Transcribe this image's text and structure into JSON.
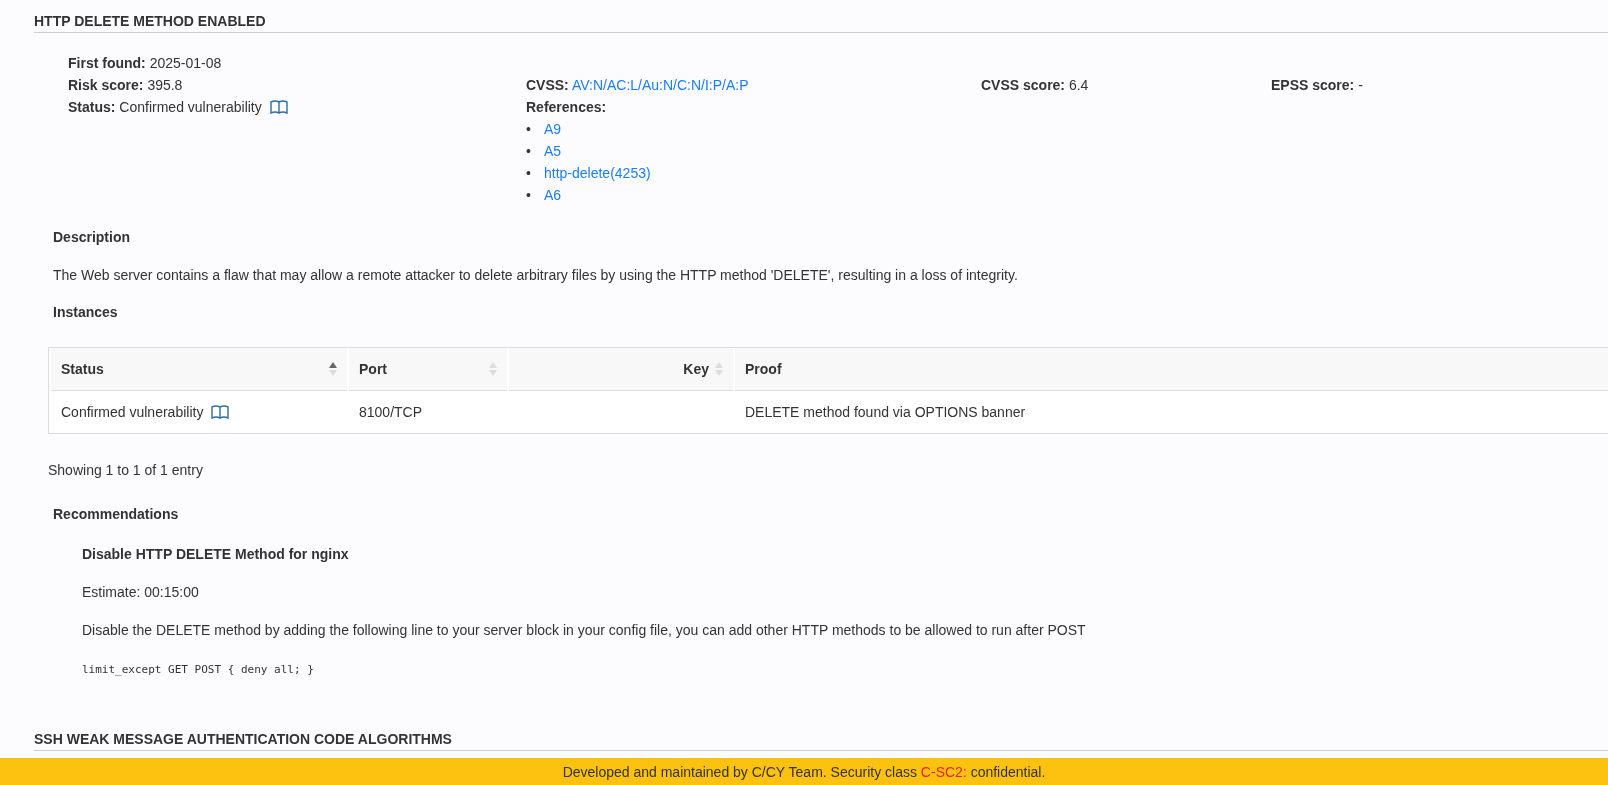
{
  "section_title": "HTTP DELETE METHOD ENABLED",
  "details": {
    "first_found": {
      "label": "First found:",
      "value": "2025-01-08"
    },
    "risk_score": {
      "label": "Risk score:",
      "value": "395.8"
    },
    "status": {
      "label": "Status:",
      "value": "Confirmed vulnerability"
    },
    "cvss": {
      "label": "CVSS:",
      "value": "AV:N/AC:L/Au:N/C:N/I:P/A:P"
    },
    "cvss_score": {
      "label": "CVSS score:",
      "value": "6.4"
    },
    "epss_score": {
      "label": "EPSS score:",
      "value": "-"
    },
    "references": {
      "label": "References:",
      "items": [
        {
          "bullet": "•",
          "text": "A9"
        },
        {
          "bullet": "•",
          "text": "A5"
        },
        {
          "bullet": "•",
          "text": "http-delete(4253)"
        },
        {
          "bullet": "•",
          "text": "A6"
        }
      ]
    }
  },
  "description": {
    "heading": "Description",
    "text": "The Web server contains a flaw that may allow a remote attacker to delete arbitrary files by using the HTTP method 'DELETE', resulting in a loss of integrity."
  },
  "instances": {
    "heading": "Instances",
    "columns": [
      {
        "kind": "sortable",
        "label": "Status",
        "sorted": true
      },
      {
        "kind": "sortable",
        "label": "Port",
        "sorted": false
      },
      {
        "kind": "sortable",
        "label": "Key",
        "sorted": false
      },
      {
        "kind": "plain",
        "label": "Proof"
      }
    ],
    "rows": [
      [
        "Confirmed vulnerability",
        "8100/TCP",
        "",
        "DELETE method found via OPTIONS banner"
      ]
    ],
    "info": "Showing 1 to 1 of 1 entry"
  },
  "recommendations": {
    "heading": "Recommendations",
    "items": [
      {
        "title": "Disable HTTP DELETE Method for nginx",
        "estimate": "Estimate: 00:15:00",
        "text": "Disable the DELETE method by adding the following line to your server block in your config file, you can add other HTTP methods to be allowed to run after POST",
        "code": "limit_except GET POST { deny all; }"
      }
    ]
  },
  "next_section_title": "SSH WEAK MESSAGE AUTHENTICATION CODE ALGORITHMS",
  "footer": {
    "before": "Developed and maintained by C/CY Team. Security class ",
    "highlight": "C-SC2:",
    "after": " confidential."
  }
}
